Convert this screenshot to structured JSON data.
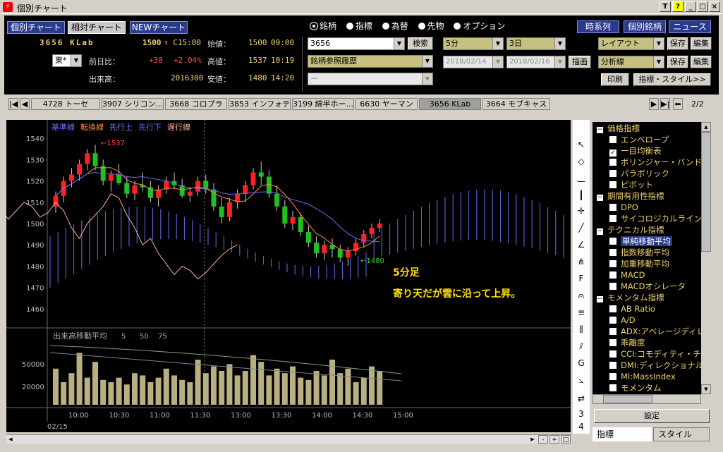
{
  "window": {
    "title": "個別チャート",
    "controls": [
      "T",
      "?",
      "_",
      "□",
      "×"
    ]
  },
  "header": {
    "tabs": [
      "個別チャート",
      "相対チャート",
      "NEWチャート"
    ],
    "symbol": "3656 KLab",
    "price": "1500",
    "price_suffix": "↑ C15:00",
    "change_label": "前日比：",
    "change": "+30",
    "change_pct": "+2.04%",
    "volume_label": "出来高：",
    "volume": "2016300",
    "open_label": "始値：",
    "open": "1500",
    "open_time": "09:00",
    "high_label": "高値：",
    "high": "1537",
    "high_time": "10:19",
    "low_label": "安値：",
    "low": "1480",
    "low_time": "14:20",
    "exchange": "東*",
    "radio": [
      "銘柄",
      "指標",
      "為替",
      "先物",
      "オプション"
    ],
    "code_input": "3656",
    "search_btn": "検索",
    "history_select": "銘柄参照履歴",
    "third_select": "ー",
    "interval": "5分",
    "period": "3日",
    "date_from": "2018/02/14",
    "date_to": "2018/02/16",
    "draw_btn": "描画",
    "layout_select": "レイアウト",
    "analysis_select": "分析線",
    "save_btn": "保存",
    "edit_btn": "編集",
    "print_btn": "印刷",
    "indicator_btn": "指標・スタイル>>",
    "right_tabs": [
      "時系列",
      "個別銘柄",
      "ニュース"
    ]
  },
  "stock_tabs": [
    "4728 トーセ",
    "3907 シリコン...",
    "3668 コロプラ",
    "3853 インフォテリ",
    "3199 綿半ホー...",
    "6630 ヤーマン",
    "3656 KLab",
    "3664 モブキャス"
  ],
  "stock_page": "2/2",
  "chart_data": {
    "type": "candlestick",
    "legend": [
      "基準線",
      "転換線",
      "先行上",
      "先行下",
      "遅行線"
    ],
    "legend_colors": [
      "#6a6aff",
      "#ff8a3a",
      "#8080ff",
      "#6a6aff",
      "#ffb0a0"
    ],
    "y_ticks": [
      1540,
      1530,
      1520,
      1510,
      1500,
      1490,
      1480,
      1470,
      1460
    ],
    "ylim": [
      1452,
      1546
    ],
    "x_ticks": [
      "10:00",
      "10:30",
      "11:00",
      "11:30",
      "13:00",
      "13:30",
      "14:00",
      "14:30",
      "15:00"
    ],
    "date_label": "02/15",
    "high_annot": "1537",
    "low_annot": "1480",
    "volume_title": "出来高移動平均",
    "volume_ma": [
      "5",
      "50",
      "75"
    ],
    "volume_ticks": [
      "50000",
      "20000"
    ],
    "candles": [
      [
        1508,
        1515,
        1505,
        1513
      ],
      [
        1513,
        1522,
        1510,
        1520
      ],
      [
        1520,
        1526,
        1517,
        1523
      ],
      [
        1523,
        1530,
        1520,
        1528
      ],
      [
        1528,
        1535,
        1525,
        1533
      ],
      [
        1533,
        1537,
        1525,
        1527
      ],
      [
        1527,
        1530,
        1518,
        1520
      ],
      [
        1520,
        1525,
        1515,
        1523
      ],
      [
        1523,
        1528,
        1518,
        1519
      ],
      [
        1519,
        1522,
        1512,
        1514
      ],
      [
        1514,
        1520,
        1511,
        1518
      ],
      [
        1518,
        1524,
        1515,
        1517
      ],
      [
        1517,
        1520,
        1510,
        1512
      ],
      [
        1512,
        1518,
        1508,
        1516
      ],
      [
        1516,
        1522,
        1514,
        1520
      ],
      [
        1520,
        1524,
        1516,
        1518
      ],
      [
        1518,
        1521,
        1512,
        1513
      ],
      [
        1513,
        1517,
        1510,
        1515
      ],
      [
        1515,
        1522,
        1513,
        1520
      ],
      [
        1520,
        1523,
        1514,
        1516
      ],
      [
        1516,
        1519,
        1506,
        1508
      ],
      [
        1508,
        1512,
        1500,
        1503
      ],
      [
        1503,
        1512,
        1501,
        1510
      ],
      [
        1510,
        1516,
        1507,
        1514
      ],
      [
        1514,
        1520,
        1510,
        1518
      ],
      [
        1518,
        1526,
        1516,
        1524
      ],
      [
        1524,
        1529,
        1518,
        1522
      ],
      [
        1522,
        1525,
        1512,
        1514
      ],
      [
        1514,
        1518,
        1506,
        1508
      ],
      [
        1508,
        1511,
        1498,
        1500
      ],
      [
        1500,
        1506,
        1497,
        1503
      ],
      [
        1503,
        1505,
        1494,
        1496
      ],
      [
        1496,
        1499,
        1489,
        1491
      ],
      [
        1491,
        1494,
        1484,
        1486
      ],
      [
        1486,
        1492,
        1483,
        1490
      ],
      [
        1490,
        1493,
        1484,
        1488
      ],
      [
        1488,
        1490,
        1482,
        1484
      ],
      [
        1484,
        1489,
        1480,
        1487
      ],
      [
        1487,
        1493,
        1485,
        1491
      ],
      [
        1491,
        1497,
        1489,
        1495
      ],
      [
        1495,
        1500,
        1493,
        1498
      ],
      [
        1498,
        1502,
        1496,
        1500
      ]
    ],
    "volumes": [
      32,
      20,
      28,
      46,
      24,
      38,
      22,
      20,
      24,
      18,
      28,
      26,
      20,
      24,
      32,
      26,
      22,
      20,
      40,
      28,
      34,
      30,
      36,
      26,
      30,
      44,
      38,
      26,
      32,
      28,
      34,
      24,
      22,
      30,
      26,
      40,
      28,
      32,
      20,
      24,
      34,
      30
    ]
  },
  "annotation": {
    "line1": "5分足",
    "line2": "寄り天だが雲に沿って上昇。"
  },
  "indicator_tree": [
    {
      "type": "group",
      "label": "価格指標"
    },
    {
      "type": "item",
      "label": "エンベロープ",
      "checked": false
    },
    {
      "type": "item",
      "label": "一目均衡表",
      "checked": true
    },
    {
      "type": "item",
      "label": "ボリンジャー・バンド",
      "checked": false
    },
    {
      "type": "item",
      "label": "パラボリック",
      "checked": false
    },
    {
      "type": "item",
      "label": "ピボット",
      "checked": false
    },
    {
      "type": "group",
      "label": "期間有用性指標"
    },
    {
      "type": "item",
      "label": "DPO",
      "checked": false
    },
    {
      "type": "item",
      "label": "サイコロジカルライン",
      "checked": false
    },
    {
      "type": "group",
      "label": "テクニカル指標"
    },
    {
      "type": "item",
      "label": "単純移動平均",
      "checked": false,
      "highlight": true
    },
    {
      "type": "item",
      "label": "指数移動平均",
      "checked": false
    },
    {
      "type": "item",
      "label": "加重移動平均",
      "checked": false
    },
    {
      "type": "item",
      "label": "MACD",
      "checked": false
    },
    {
      "type": "item",
      "label": "MACDオシレータ",
      "checked": false
    },
    {
      "type": "group",
      "label": "モメンタム指標"
    },
    {
      "type": "item",
      "label": "AB Ratio",
      "checked": false
    },
    {
      "type": "item",
      "label": "A/D",
      "checked": false
    },
    {
      "type": "item",
      "label": "ADX:アベレージディレ",
      "checked": false
    },
    {
      "type": "item",
      "label": "乖離度",
      "checked": false
    },
    {
      "type": "item",
      "label": "CCI:コモディティ・チャ",
      "checked": false
    },
    {
      "type": "item",
      "label": "DMI:ディレクショナル",
      "checked": false
    },
    {
      "type": "item",
      "label": "MI:MassIndex",
      "checked": false
    },
    {
      "type": "item",
      "label": "モメンタム",
      "checked": false
    }
  ],
  "panel": {
    "settings_btn": "設定",
    "bottom_tabs": [
      "指標",
      "スタイル"
    ]
  }
}
